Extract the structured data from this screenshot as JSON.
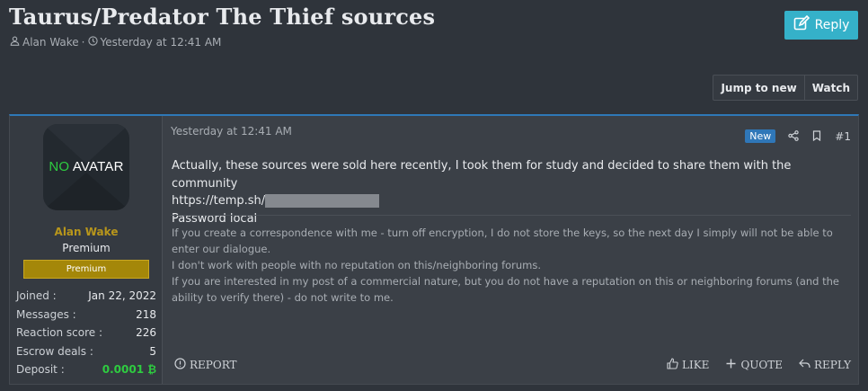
{
  "thread": {
    "title": "Taurus/Predator The Thief sources",
    "author": "Alan Wake",
    "separator": "·",
    "date": "Yesterday at 12:41 AM"
  },
  "toolbar": {
    "reply_label": "Reply",
    "jump_label": "Jump to new",
    "watch_label": "Watch"
  },
  "user": {
    "avatar_no": "NO",
    "avatar_av": "AVATAR",
    "name": "Alan Wake",
    "title": "Premium",
    "banner": "Premium",
    "stats": [
      {
        "label": "Joined :",
        "value": "Jan 22, 2022"
      },
      {
        "label": "Messages :",
        "value": "218"
      },
      {
        "label": "Reaction score :",
        "value": "226"
      },
      {
        "label": "Escrow deals :",
        "value": "5"
      },
      {
        "label": "Deposit :",
        "value": "0.0001 ₿"
      }
    ]
  },
  "post": {
    "date": "Yesterday at 12:41 AM",
    "new_badge": "New",
    "number": "#1",
    "line1": "Actually, these sources were sold here recently, I took them for study and decided to share them with the community",
    "link": "https://temp.sh/",
    "line3": "Password local",
    "signature": [
      "If you create a correspondence with me - turn off encryption, I do not store the keys, so the next day I simply will not be able to enter our dialogue.",
      "I don't work with people with no reputation on this/neighboring forums.",
      "If you are interested in my post of a commercial nature, but you do not have a reputation on this or neighboring forums (and the ability to verify there) - do not write to me."
    ]
  },
  "footer": {
    "report": "REPORT",
    "like": "LIKE",
    "quote": "QUOTE",
    "reply": "REPLY"
  },
  "colors": {
    "accent_reply": "#35b1c9",
    "post_border": "#2e78b7",
    "username": "#b8961b",
    "banner": "#a48709",
    "deposit": "#2ecc40",
    "new_badge": "#2f77b8"
  },
  "icons": {
    "author": "user-icon",
    "date": "clock-icon",
    "reply": "edit-icon",
    "share": "share-icon",
    "bookmark": "bookmark-icon",
    "report": "warning-icon",
    "like": "thumbs-up-icon",
    "quote": "plus-icon",
    "reply_footer": "reply-arrow-icon"
  }
}
